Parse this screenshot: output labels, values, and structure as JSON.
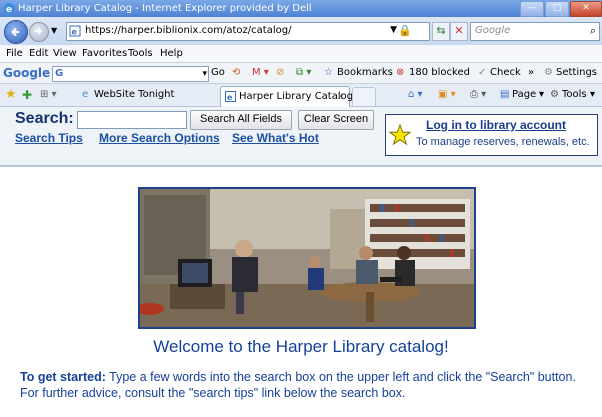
{
  "window": {
    "title": "Harper Library Catalog - Internet Explorer provided by Dell",
    "minimize_glyph": "—",
    "maximize_glyph": "□",
    "close_glyph": "✕"
  },
  "address_bar": {
    "url": "https://harper.biblionix.com/atoz/catalog/",
    "search_placeholder": "Google"
  },
  "menu": [
    "File",
    "Edit",
    "View",
    "Favorites",
    "Tools",
    "Help"
  ],
  "google_toolbar": {
    "logo": "Google",
    "go_label": "Go",
    "bookmarks_label": "Bookmarks",
    "blocked_label": "180 blocked",
    "check_label": "Check",
    "more_label": "»",
    "settings_label": "Settings"
  },
  "tabs": {
    "other_tab_label": "WebSite Tonight",
    "active_tab_label": "Harper Library Catalog",
    "active_tab_close": "x",
    "page_label": "Page",
    "tools_label": "Tools"
  },
  "catalog": {
    "search_label": "Search:",
    "search_value": "",
    "search_all_button": "Search All Fields",
    "clear_button": "Clear Screen",
    "links": [
      "Search Tips",
      "More Search Options",
      "See What's Hot"
    ],
    "login_title": "Log in to library account",
    "login_subtitle": "To manage reserves, renewals, etc."
  },
  "main": {
    "welcome": "Welcome to the Harper Library catalog!",
    "get_started_label": "To get started:",
    "get_started_text": " Type a few words into the search box on the upper left and click the \"Search\" button. For further advice, consult the \"search tips\" link below the search box."
  },
  "colors": {
    "brand_blue": "#15409a",
    "header_bg": "#eef3f8",
    "link_blue": "#1a4fa3"
  }
}
